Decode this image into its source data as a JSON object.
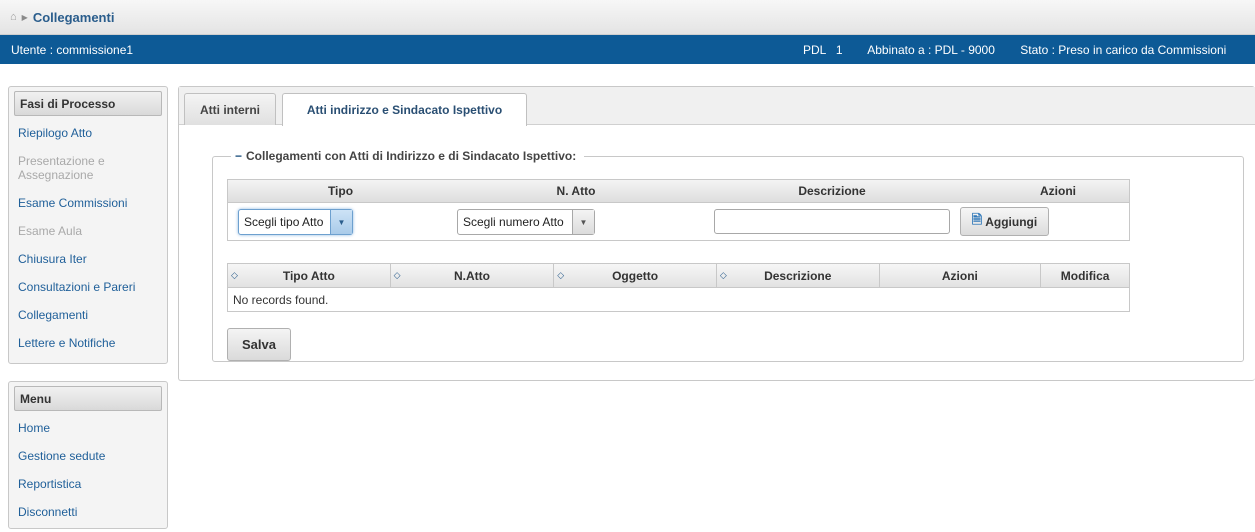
{
  "breadcrumb": {
    "home_icon": "home-icon",
    "current": "Collegamenti"
  },
  "userbar": {
    "user": "Utente : commissione1",
    "pdl": "PDL   1",
    "abbinato": "Abbinato a : PDL - 9000",
    "stato": "Stato : Preso in carico da Commissioni"
  },
  "sidebar": {
    "fasi": {
      "title": "Fasi di Processo",
      "items": [
        {
          "label": "Riepilogo Atto"
        },
        {
          "label": "Presentazione e Assegnazione"
        },
        {
          "label": "Esame Commissioni"
        },
        {
          "label": "Esame Aula"
        },
        {
          "label": "Chiusura Iter"
        },
        {
          "label": "Consultazioni e Pareri"
        },
        {
          "label": "Collegamenti"
        },
        {
          "label": "Lettere e Notifiche"
        }
      ]
    },
    "menu": {
      "title": "Menu",
      "items": [
        {
          "label": "Home"
        },
        {
          "label": "Gestione sedute"
        },
        {
          "label": "Reportistica"
        },
        {
          "label": "Disconnetti"
        }
      ]
    }
  },
  "tabs": [
    {
      "label": "Atti interni"
    },
    {
      "label": "Atti indirizzo e Sindacato Ispettivo"
    }
  ],
  "group": {
    "legend": "Collegamenti con Atti di Indirizzo e di Sindacato Ispettivo:",
    "entry": {
      "headers": {
        "tipo": "Tipo",
        "natto": "N. Atto",
        "descrizione": "Descrizione",
        "azioni": "Azioni"
      },
      "tipo_select": "Scegli tipo Atto",
      "numero_select": "Scegli numero Atto",
      "descrizione_value": "",
      "add_label": "Aggiungi"
    },
    "results": {
      "headers": [
        "Tipo Atto",
        "N.Atto",
        "Oggetto",
        "Descrizione",
        "Azioni",
        "Modifica"
      ],
      "empty_message": "No records found."
    },
    "save_label": "Salva"
  }
}
